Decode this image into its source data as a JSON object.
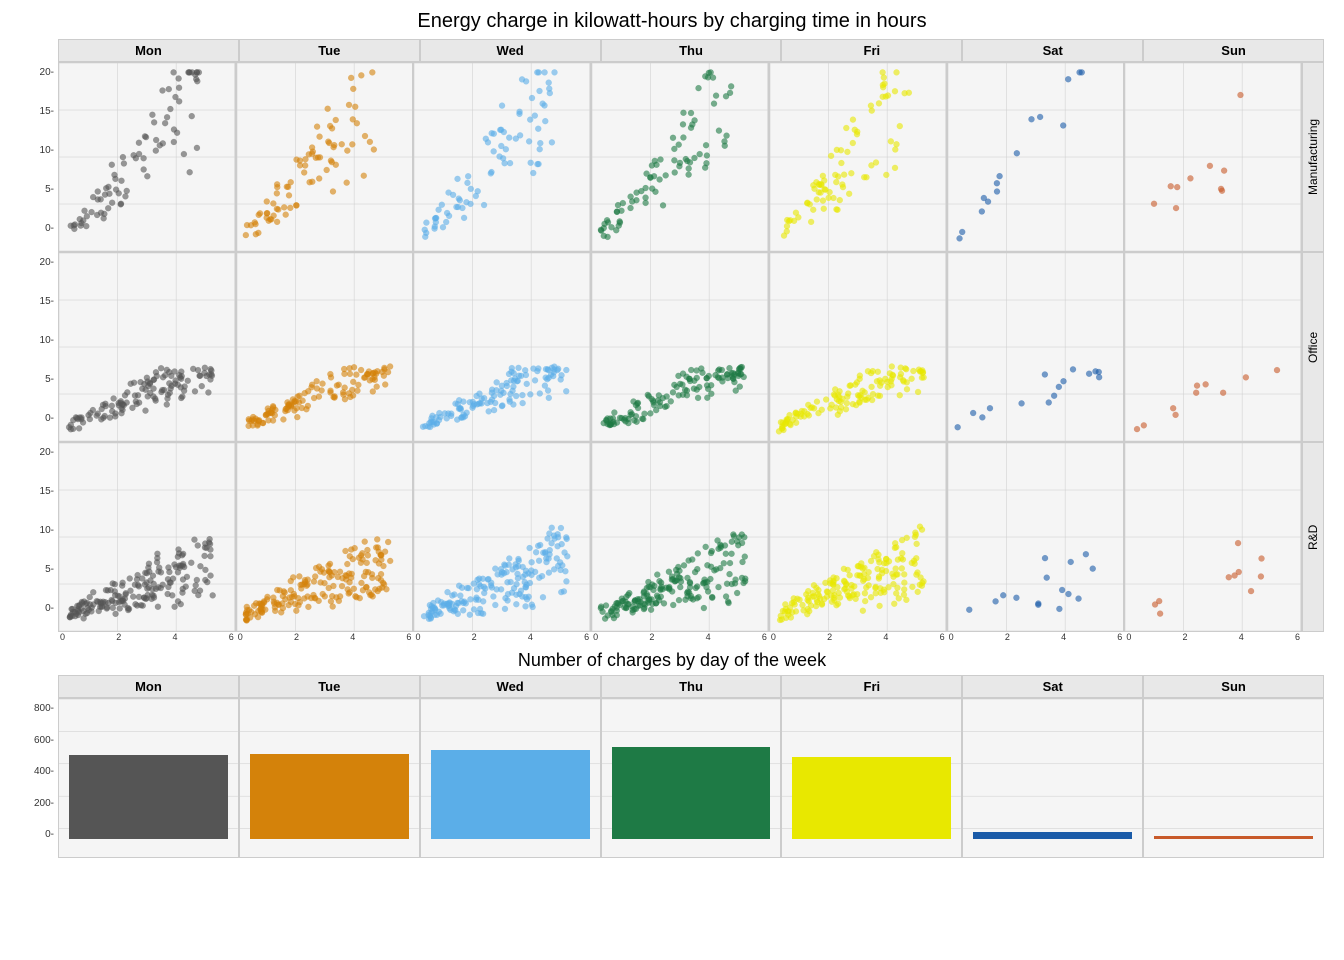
{
  "scatter_title": "Energy charge in kilowatt-hours by charging time in hours",
  "bar_title": "Number of charges by day of the week",
  "days": [
    "Mon",
    "Tue",
    "Wed",
    "Thu",
    "Fri",
    "Sat",
    "Sun"
  ],
  "row_labels": [
    "Manufacturing",
    "Office",
    "R&D"
  ],
  "colors": {
    "Mon": "#555555",
    "Tue": "#D4820A",
    "Wed": "#5BAEE8",
    "Thu": "#1E7A45",
    "Fri": "#E8E800",
    "Sat": "#1A5BA8",
    "Sun": "#C85A2A"
  },
  "y_axis_scatter": [
    "20-",
    "15-",
    "10-",
    "5-",
    "0-"
  ],
  "y_axis_scatter_vals": [
    20,
    15,
    10,
    5,
    0
  ],
  "x_axis_vals": [
    "0",
    "2",
    "4",
    "6"
  ],
  "y_axis_bar": [
    "800-",
    "600-",
    "400-",
    "200-",
    "0-"
  ],
  "bar_heights": {
    "Mon": 0.76,
    "Tue": 0.77,
    "Wed": 0.81,
    "Thu": 0.84,
    "Fri": 0.75,
    "Sat": 0.06,
    "Sun": 0.03
  }
}
